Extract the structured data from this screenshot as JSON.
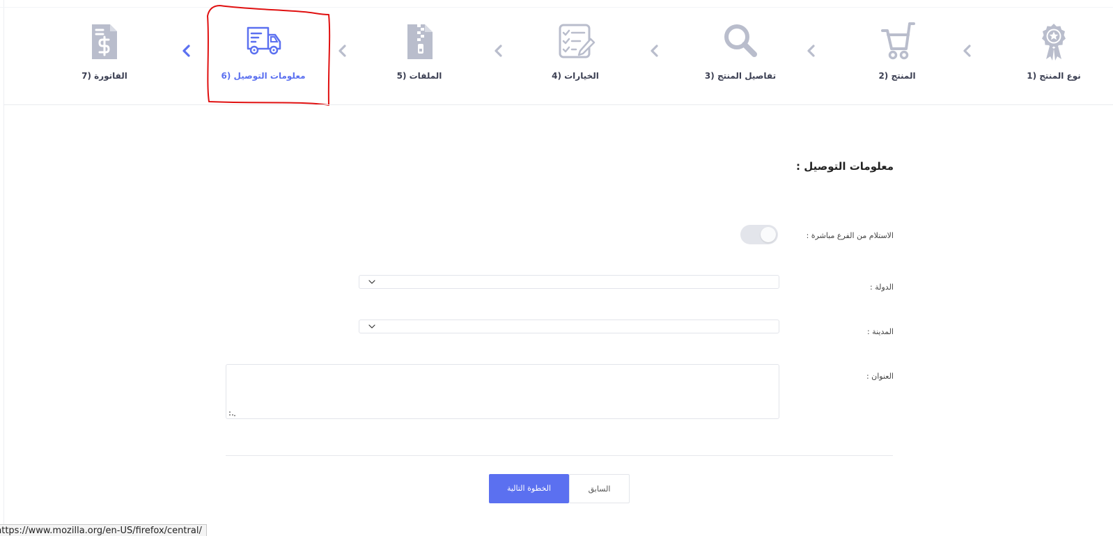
{
  "stepper": {
    "steps": [
      {
        "number": "1",
        "label": "1) نوع المنتج",
        "icon": "award-badge-icon",
        "active": false
      },
      {
        "number": "2",
        "label": "2) المنتج",
        "icon": "shopping-cart-icon",
        "active": false
      },
      {
        "number": "3",
        "label": "3) تفاصيل المنتج",
        "icon": "magnifier-icon",
        "active": false
      },
      {
        "number": "4",
        "label": "4) الخيارات",
        "icon": "checklist-icon",
        "active": false
      },
      {
        "number": "5",
        "label": "5) الملفات",
        "icon": "zip-file-icon",
        "active": false
      },
      {
        "number": "6",
        "label": "6) معلومات التوصيل",
        "icon": "delivery-truck-icon",
        "active": true
      },
      {
        "number": "7",
        "label": "7) الفاتورة",
        "icon": "invoice-dollar-icon",
        "active": false
      }
    ]
  },
  "form": {
    "title": "معلومات التوصيل :",
    "pickup_label": "الاستلام من الفرع مباشرة :",
    "pickup_enabled": false,
    "country_label": "الدولة :",
    "country_value": "",
    "city_label": "المدينة :",
    "city_value": "",
    "address_label": "العنوان :",
    "address_value": ""
  },
  "actions": {
    "next_label": "الخطوة التالية",
    "previous_label": "السابق"
  },
  "status_bar": {
    "url": "https://www.mozilla.org/en-US/firefox/central/"
  },
  "colors": {
    "accent": "#5b70f0",
    "icon_gray": "#b9bdcc",
    "annotation_red": "#e01010"
  }
}
